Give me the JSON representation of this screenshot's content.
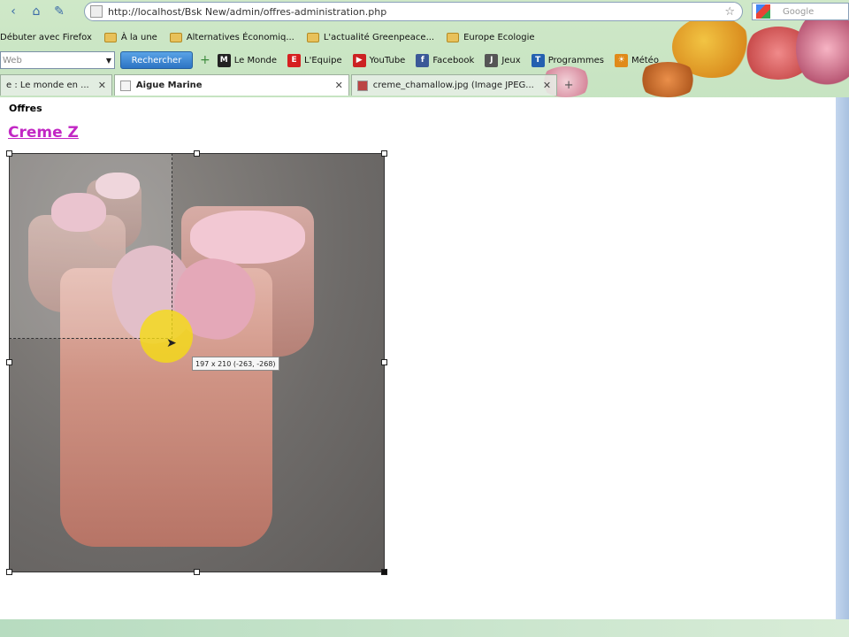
{
  "browser": {
    "url": "http://localhost/Bsk New/admin/offres-administration.php",
    "search_engine_placeholder": "Google"
  },
  "bookmarks": [
    {
      "label": "Débuter avec Firefox",
      "icon": "firefox-icon"
    },
    {
      "label": "À la une",
      "icon": "folder-icon"
    },
    {
      "label": "Alternatives Économiq...",
      "icon": "folder-icon"
    },
    {
      "label": "L'actualité Greenpeace...",
      "icon": "folder-icon"
    },
    {
      "label": "Europe Ecologie",
      "icon": "folder-icon"
    }
  ],
  "toolbar": {
    "web_search_placeholder": "Web",
    "search_button": "Rechercher",
    "items": [
      {
        "label": "Le Monde",
        "icon": "le-monde-icon",
        "color": "#222222",
        "glyph": "M"
      },
      {
        "label": "L'Equipe",
        "icon": "lequipe-icon",
        "color": "#d62020",
        "glyph": "E"
      },
      {
        "label": "YouTube",
        "icon": "youtube-icon",
        "color": "#cc2222",
        "glyph": "▶"
      },
      {
        "label": "Facebook",
        "icon": "facebook-icon",
        "color": "#3b5998",
        "glyph": "f"
      },
      {
        "label": "Jeux",
        "icon": "jeux-icon",
        "color": "#555555",
        "glyph": "J"
      },
      {
        "label": "Programmes",
        "icon": "programmes-icon",
        "color": "#2460b0",
        "glyph": "T"
      },
      {
        "label": "Météo",
        "icon": "meteo-icon",
        "color": "#e08a1a",
        "glyph": "☀"
      }
    ]
  },
  "tabs": [
    {
      "label": "e : Le monde en ...",
      "active": false
    },
    {
      "label": "Aigue Marine",
      "active": true
    },
    {
      "label": "creme_chamallow.jpg (Image JPEG...",
      "active": false
    }
  ],
  "page": {
    "section_label": "Offres",
    "title": "Creme Z",
    "crop_tooltip": "197 x 210 (-263, -268)"
  }
}
